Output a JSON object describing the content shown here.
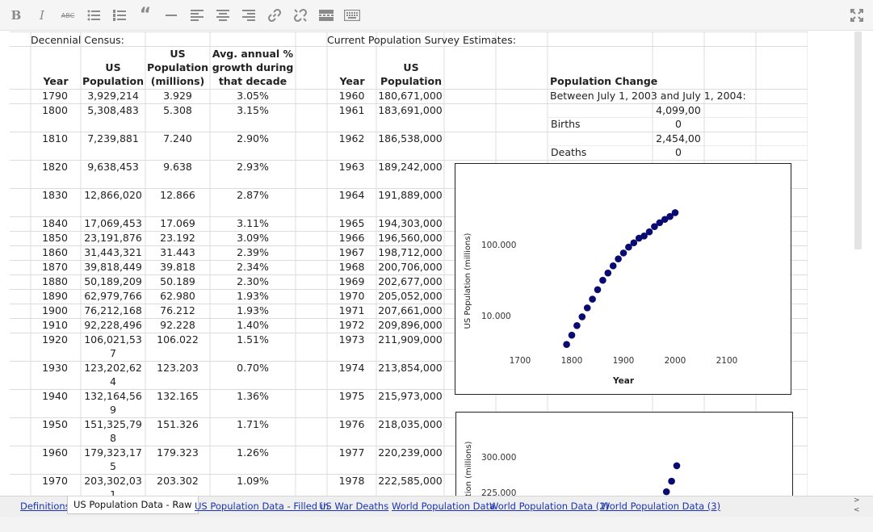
{
  "toolbar": {
    "buttons": [
      {
        "name": "bold-button",
        "glyph": "B"
      },
      {
        "name": "italic-button",
        "glyph": "I"
      },
      {
        "name": "strikethrough-button",
        "glyph": "ABC"
      }
    ]
  },
  "sheet": {
    "left_header": "Decennial Census:",
    "right_header": "Current Population Survey Estimates:",
    "left_cols": {
      "year": "Year",
      "pop_top": "US",
      "pop_bottom": "Population",
      "mil_top": "US",
      "mil_mid": "Population",
      "mil_bottom": "(millions)",
      "growth_1": "Avg. annual %",
      "growth_2": "growth during",
      "growth_3": "that decade"
    },
    "right_cols": {
      "year": "Year",
      "pop_top": "US",
      "pop_bottom": "Population"
    },
    "census_rows": [
      {
        "year": "1790",
        "pop": "3,929,214",
        "mil": "3.929",
        "growth": "3.05%"
      },
      {
        "year": "1800",
        "pop": "5,308,483",
        "mil": "5.308",
        "growth": "3.15%"
      },
      {
        "year": "1810",
        "pop": "7,239,881",
        "mil": "7.240",
        "growth": "2.90%"
      },
      {
        "year": "1820",
        "pop": "9,638,453",
        "mil": "9.638",
        "growth": "2.93%"
      },
      {
        "year": "1830",
        "pop": "12,866,020",
        "mil": "12.866",
        "growth": "2.87%"
      },
      {
        "year": "1840",
        "pop": "17,069,453",
        "mil": "17.069",
        "growth": "3.11%"
      },
      {
        "year": "1850",
        "pop": "23,191,876",
        "mil": "23.192",
        "growth": "3.09%"
      },
      {
        "year": "1860",
        "pop": "31,443,321",
        "mil": "31.443",
        "growth": "2.39%"
      },
      {
        "year": "1870",
        "pop": "39,818,449",
        "mil": "39.818",
        "growth": "2.34%"
      },
      {
        "year": "1880",
        "pop": "50,189,209",
        "mil": "50.189",
        "growth": "2.30%"
      },
      {
        "year": "1890",
        "pop": "62,979,766",
        "mil": "62.980",
        "growth": "1.93%"
      },
      {
        "year": "1900",
        "pop": "76,212,168",
        "mil": "76.212",
        "growth": "1.93%"
      },
      {
        "year": "1910",
        "pop": "92,228,496",
        "mil": "92.228",
        "growth": "1.40%"
      },
      {
        "year": "1920",
        "pop": "106,021,53",
        "pop2": "7",
        "mil": "106.022",
        "growth": "1.51%"
      },
      {
        "year": "1930",
        "pop": "123,202,62",
        "pop2": "4",
        "mil": "123.203",
        "growth": "0.70%"
      },
      {
        "year": "1940",
        "pop": "132,164,56",
        "pop2": "9",
        "mil": "132.165",
        "growth": "1.36%"
      },
      {
        "year": "1950",
        "pop": "151,325,79",
        "pop2": "8",
        "mil": "151.326",
        "growth": "1.71%"
      },
      {
        "year": "1960",
        "pop": "179,323,17",
        "pop2": "5",
        "mil": "179.323",
        "growth": "1.26%"
      },
      {
        "year": "1970",
        "pop": "203,302,03",
        "pop2": "1",
        "mil": "203.302",
        "growth": "1.09%"
      }
    ],
    "cps_rows": [
      {
        "year": "1960",
        "pop": "180,671,000"
      },
      {
        "year": "1961",
        "pop": "183,691,000"
      },
      {
        "year": "1962",
        "pop": "186,538,000"
      },
      {
        "year": "1963",
        "pop": "189,242,000"
      },
      {
        "year": "1964",
        "pop": "191,889,000"
      },
      {
        "year": "1965",
        "pop": "194,303,000"
      },
      {
        "year": "1966",
        "pop": "196,560,000"
      },
      {
        "year": "1967",
        "pop": "198,712,000"
      },
      {
        "year": "1968",
        "pop": "200,706,000"
      },
      {
        "year": "1969",
        "pop": "202,677,000"
      },
      {
        "year": "1970",
        "pop": "205,052,000"
      },
      {
        "year": "1971",
        "pop": "207,661,000"
      },
      {
        "year": "1972",
        "pop": "209,896,000"
      },
      {
        "year": "1973",
        "pop": "211,909,000"
      },
      {
        "year": "1974",
        "pop": "213,854,000"
      },
      {
        "year": "1975",
        "pop": "215,973,000"
      },
      {
        "year": "1976",
        "pop": "218,035,000"
      },
      {
        "year": "1977",
        "pop": "220,239,000"
      },
      {
        "year": "1978",
        "pop": "222,585,000"
      }
    ],
    "pop_change": {
      "title": "Population Change",
      "between": "Between July 1, 2003 and July 1, 2004:",
      "births_label": "Births",
      "births_value_1": "4,099,00",
      "births_value_2": "0",
      "deaths_label": "Deaths",
      "deaths_value_1": "2,454,00",
      "deaths_value_2": "0"
    }
  },
  "chart_data": [
    {
      "type": "scatter",
      "title": "",
      "xlabel": "Year",
      "ylabel": "US Population (millions)",
      "yscale": "log",
      "x_ticks": [
        "1700",
        "1800",
        "1900",
        "2000",
        "2100"
      ],
      "y_ticks": [
        "10.000",
        "100.000"
      ],
      "xlim": [
        1650,
        2150
      ],
      "ylim": [
        2.5,
        600
      ],
      "grid": false,
      "color": "#0a0a73",
      "series": [
        {
          "x": [
            1790,
            1800,
            1810,
            1820,
            1830,
            1840,
            1850,
            1860,
            1870,
            1880,
            1890,
            1900,
            1910,
            1920,
            1930,
            1940,
            1950,
            1960,
            1970,
            1980,
            1990,
            2000
          ],
          "y": [
            3.929,
            5.308,
            7.24,
            9.638,
            12.866,
            17.069,
            23.192,
            31.443,
            39.818,
            50.189,
            62.98,
            76.212,
            92.228,
            106.022,
            123.203,
            132.165,
            151.326,
            179.323,
            203.302,
            226.5,
            248.7,
            281.4
          ]
        }
      ]
    },
    {
      "type": "scatter",
      "title": "",
      "xlabel": "",
      "ylabel": "US Population (millions)",
      "y_ticks": [
        "225.000",
        "300.000"
      ],
      "xlim": [
        1650,
        2150
      ],
      "ylim": [
        180,
        360
      ],
      "grid": false,
      "color": "#0a0a73",
      "series": [
        {
          "x": [
            1980,
            1990,
            2000
          ],
          "y": [
            226.5,
            248.7,
            281.4
          ]
        }
      ]
    }
  ],
  "sheet_tabs": [
    {
      "label": "Definitions",
      "active": false
    },
    {
      "label": "US Population Data - Raw",
      "active": true
    },
    {
      "label": "US Population Data - Filled in",
      "active": false
    },
    {
      "label": "US War Deaths",
      "active": false
    },
    {
      "label": "World Population Data",
      "active": false
    },
    {
      "label": "World Population Data (2)",
      "active": false
    },
    {
      "label": "World Population Data (3)",
      "active": false
    }
  ],
  "tab_nav": {
    "up": ">",
    "down": "<"
  }
}
